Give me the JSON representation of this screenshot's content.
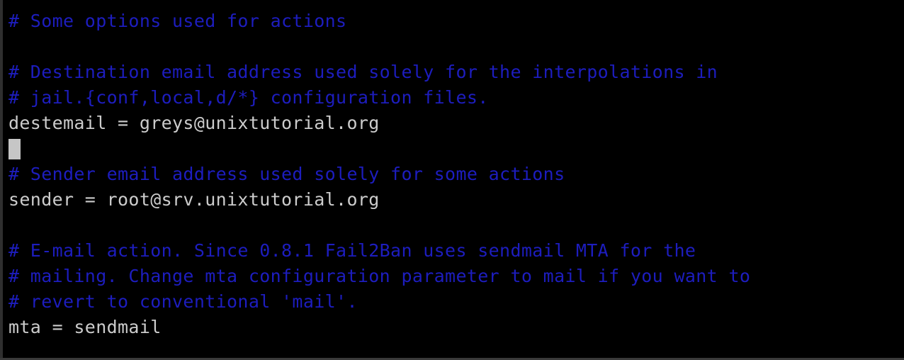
{
  "window": {
    "type": "terminal",
    "title": "terminal",
    "background_color": "#000000",
    "foreground_color": "#cccccc",
    "comment_color": "#1d1dbe",
    "cursor_color": "#c6c6c6",
    "border_color": "#2f2f2f",
    "columns": 72,
    "rows": 14
  },
  "editor": {
    "file_type": "fail2ban jail configuration",
    "cursor": {
      "row": 5,
      "column": 0,
      "shape": "block",
      "color": "#c6c6c6"
    }
  },
  "lines": [
    {
      "id": "line-1",
      "kind": "comment",
      "text": "# Some options used for actions"
    },
    {
      "id": "line-2",
      "kind": "blank",
      "text": ""
    },
    {
      "id": "line-3",
      "kind": "comment",
      "text": "# Destination email address used solely for the interpolations in"
    },
    {
      "id": "line-4",
      "kind": "comment",
      "text": "# jail.{conf,local,d/*} configuration files."
    },
    {
      "id": "line-5",
      "kind": "code",
      "text": "destemail = greys@unixtutorial.org"
    },
    {
      "id": "line-6",
      "kind": "blank",
      "text": "",
      "cursor": true
    },
    {
      "id": "line-7",
      "kind": "comment",
      "text": "# Sender email address used solely for some actions"
    },
    {
      "id": "line-8",
      "kind": "code",
      "text": "sender = root@srv.unixtutorial.org"
    },
    {
      "id": "line-9",
      "kind": "blank",
      "text": ""
    },
    {
      "id": "line-10",
      "kind": "comment",
      "text": "# E-mail action. Since 0.8.1 Fail2Ban uses sendmail MTA for the"
    },
    {
      "id": "line-11",
      "kind": "comment",
      "text": "# mailing. Change mta configuration parameter to mail if you want to"
    },
    {
      "id": "line-12",
      "kind": "comment",
      "text": "# revert to conventional 'mail'."
    },
    {
      "id": "line-13",
      "kind": "code",
      "text": "mta = sendmail"
    },
    {
      "id": "line-14",
      "kind": "blank",
      "text": ""
    }
  ],
  "settings": {
    "destemail": "greys@unixtutorial.org",
    "sender": "root@srv.unixtutorial.org",
    "mta": "sendmail"
  }
}
